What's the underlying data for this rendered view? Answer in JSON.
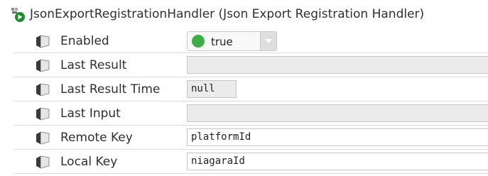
{
  "component": {
    "title": "JsonExportRegistrationHandler  (Json Export Registration Handler)",
    "icon": "component-icon"
  },
  "properties": [
    {
      "label": "Enabled",
      "type": "boolean",
      "value": "true",
      "status_color": "#3fae4a",
      "icon": "slot-icon"
    },
    {
      "label": "Last Result",
      "type": "readonly",
      "value": ""
    },
    {
      "label": "Last Result Time",
      "type": "readonly-small",
      "value": "null"
    },
    {
      "label": "Last Input",
      "type": "readonly",
      "value": ""
    },
    {
      "label": "Remote Key",
      "type": "text",
      "value": "platformId"
    },
    {
      "label": "Local Key",
      "type": "text",
      "value": "niagaraId"
    }
  ]
}
